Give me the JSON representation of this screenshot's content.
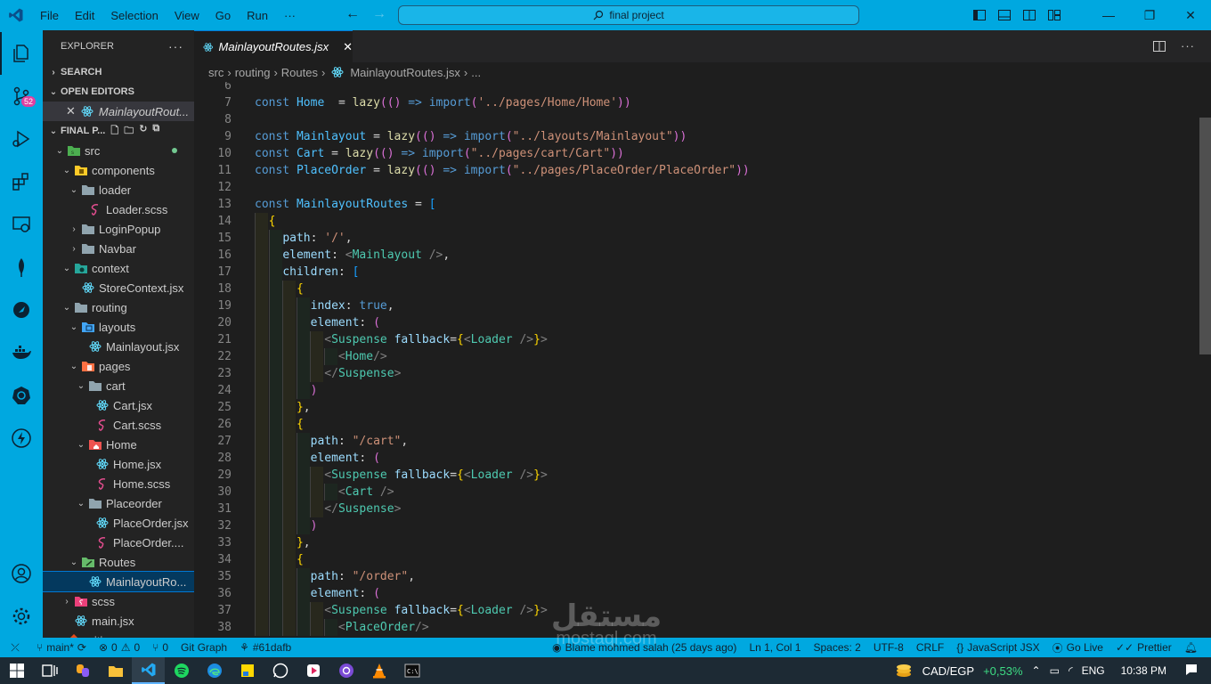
{
  "titlebar": {
    "menu": [
      "File",
      "Edit",
      "Selection",
      "View",
      "Go",
      "Run",
      "···"
    ],
    "search": "final project"
  },
  "activity": {
    "scm_badge": "52"
  },
  "sidebar": {
    "header": "EXPLORER",
    "sections": {
      "search": "SEARCH",
      "open_editors": "OPEN EDITORS",
      "folder": "FINAL P..."
    },
    "open_editor_file": "MainlayoutRout...",
    "tree": [
      {
        "label": "src",
        "depth": 1,
        "arrow": "⌄",
        "icon": "folder-src-icon"
      },
      {
        "label": "components",
        "depth": 2,
        "arrow": "⌄",
        "icon": "folder-components-icon"
      },
      {
        "label": "loader",
        "depth": 3,
        "arrow": "⌄",
        "icon": "folder-icon"
      },
      {
        "label": "Loader.scss",
        "depth": 4,
        "arrow": "",
        "icon": "scss-icon"
      },
      {
        "label": "LoginPopup",
        "depth": 3,
        "arrow": "›",
        "icon": "folder-icon"
      },
      {
        "label": "Navbar",
        "depth": 3,
        "arrow": "›",
        "icon": "folder-icon"
      },
      {
        "label": "context",
        "depth": 2,
        "arrow": "⌄",
        "icon": "folder-context-icon"
      },
      {
        "label": "StoreContext.jsx",
        "depth": 3,
        "arrow": "",
        "icon": "react-icon"
      },
      {
        "label": "routing",
        "depth": 2,
        "arrow": "⌄",
        "icon": "folder-icon"
      },
      {
        "label": "layouts",
        "depth": 3,
        "arrow": "⌄",
        "icon": "folder-layouts-icon"
      },
      {
        "label": "Mainlayout.jsx",
        "depth": 4,
        "arrow": "",
        "icon": "react-icon"
      },
      {
        "label": "pages",
        "depth": 3,
        "arrow": "⌄",
        "icon": "folder-pages-icon"
      },
      {
        "label": "cart",
        "depth": 4,
        "arrow": "⌄",
        "icon": "folder-icon"
      },
      {
        "label": "Cart.jsx",
        "depth": 5,
        "arrow": "",
        "icon": "react-icon"
      },
      {
        "label": "Cart.scss",
        "depth": 5,
        "arrow": "",
        "icon": "scss-icon"
      },
      {
        "label": "Home",
        "depth": 4,
        "arrow": "⌄",
        "icon": "folder-home-icon"
      },
      {
        "label": "Home.jsx",
        "depth": 5,
        "arrow": "",
        "icon": "react-icon"
      },
      {
        "label": "Home.scss",
        "depth": 5,
        "arrow": "",
        "icon": "scss-icon"
      },
      {
        "label": "Placeorder",
        "depth": 4,
        "arrow": "⌄",
        "icon": "folder-icon"
      },
      {
        "label": "PlaceOrder.jsx",
        "depth": 5,
        "arrow": "",
        "icon": "react-icon"
      },
      {
        "label": "PlaceOrder....",
        "depth": 5,
        "arrow": "",
        "icon": "scss-icon"
      },
      {
        "label": "Routes",
        "depth": 3,
        "arrow": "⌄",
        "icon": "folder-routes-icon"
      },
      {
        "label": "MainlayoutRo...",
        "depth": 4,
        "arrow": "",
        "icon": "react-icon",
        "selected": true
      },
      {
        "label": "scss",
        "depth": 2,
        "arrow": "›",
        "icon": "folder-scss-icon"
      },
      {
        "label": "main.jsx",
        "depth": 2,
        "arrow": "",
        "icon": "react-icon"
      },
      {
        "label": ".gitignore",
        "depth": 1,
        "arrow": "",
        "icon": "git-icon"
      }
    ]
  },
  "tab": {
    "label": "MainlayoutRoutes.jsx",
    "close": "✕"
  },
  "breadcrumb": [
    "src",
    "routing",
    "Routes",
    "MainlayoutRoutes.jsx",
    "..."
  ],
  "code_lines": [
    {
      "n": "6",
      "text": ""
    },
    {
      "n": "7",
      "text": "const Home  = lazy(() => import('../pages/Home/Home'))"
    },
    {
      "n": "8",
      "text": ""
    },
    {
      "n": "9",
      "text": "const Mainlayout = lazy(() => import(\"../layouts/Mainlayout\"))"
    },
    {
      "n": "10",
      "text": "const Cart = lazy(() => import(\"../pages/cart/Cart\"))"
    },
    {
      "n": "11",
      "text": "const PlaceOrder = lazy(() => import(\"../pages/PlaceOrder/PlaceOrder\"))"
    },
    {
      "n": "12",
      "text": ""
    },
    {
      "n": "13",
      "text": "const MainlayoutRoutes = ["
    },
    {
      "n": "14",
      "text": "  {"
    },
    {
      "n": "15",
      "text": "    path: '/',"
    },
    {
      "n": "16",
      "text": "    element: <Mainlayout />,"
    },
    {
      "n": "17",
      "text": "    children: ["
    },
    {
      "n": "18",
      "text": "      {"
    },
    {
      "n": "19",
      "text": "        index: true,"
    },
    {
      "n": "20",
      "text": "        element: ("
    },
    {
      "n": "21",
      "text": "          <Suspense fallback={<Loader />}>"
    },
    {
      "n": "22",
      "text": "            <Home/>"
    },
    {
      "n": "23",
      "text": "          </Suspense>"
    },
    {
      "n": "24",
      "text": "        )"
    },
    {
      "n": "25",
      "text": "      },"
    },
    {
      "n": "26",
      "text": "      {"
    },
    {
      "n": "27",
      "text": "        path: \"/cart\","
    },
    {
      "n": "28",
      "text": "        element: ("
    },
    {
      "n": "29",
      "text": "          <Suspense fallback={<Loader />}>"
    },
    {
      "n": "30",
      "text": "            <Cart />"
    },
    {
      "n": "31",
      "text": "          </Suspense>"
    },
    {
      "n": "32",
      "text": "        )"
    },
    {
      "n": "33",
      "text": "      },"
    },
    {
      "n": "34",
      "text": "      {"
    },
    {
      "n": "35",
      "text": "        path: \"/order\","
    },
    {
      "n": "36",
      "text": "        element: ("
    },
    {
      "n": "37",
      "text": "          <Suspense fallback={<Loader />}>"
    },
    {
      "n": "38",
      "text": "            <PlaceOrder/>"
    }
  ],
  "statusbar": {
    "branch": "main*",
    "problems_errors": "0",
    "problems_warnings": "0",
    "ports": "0",
    "git_graph": "Git Graph",
    "commit": "#61dafb",
    "blame": "Blame mohmed salah (25 days ago)",
    "position": "Ln 1, Col 1",
    "spaces": "Spaces: 2",
    "encoding": "UTF-8",
    "eol": "CRLF",
    "language": "JavaScript JSX",
    "golive": "Go Live",
    "prettier": "Prettier"
  },
  "taskbar": {
    "currency": "CAD/EGP",
    "change": "+0,53%",
    "lang": "ENG",
    "time": "10:38 PM"
  },
  "watermark": {
    "arabic": "مستقل",
    "latin": "mostaql.com"
  },
  "colors": {
    "accent": "#00a8e0",
    "editor_bg": "#1e1e1e",
    "sidebar_bg": "#232323"
  }
}
